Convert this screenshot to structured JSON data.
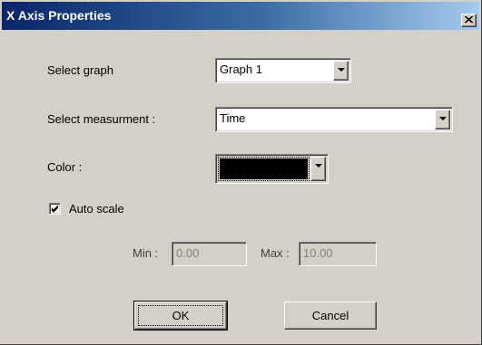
{
  "window": {
    "title": "X Axis Properties"
  },
  "select_graph": {
    "label": "Select graph",
    "value": "Graph 1"
  },
  "select_measurement": {
    "label": "Select measurment :",
    "value": "Time"
  },
  "color": {
    "label": "Color :",
    "value_hex": "#000000"
  },
  "auto_scale": {
    "label": "Auto scale",
    "checked": true
  },
  "min": {
    "label": "Min :",
    "value": "0.00"
  },
  "max": {
    "label": "Max :",
    "value": "10.00"
  },
  "buttons": {
    "ok_label": "OK",
    "cancel_label": "Cancel"
  },
  "icons": {
    "close": "close-icon",
    "dropdown": "chevron-down-icon",
    "check": "checkmark-icon"
  }
}
